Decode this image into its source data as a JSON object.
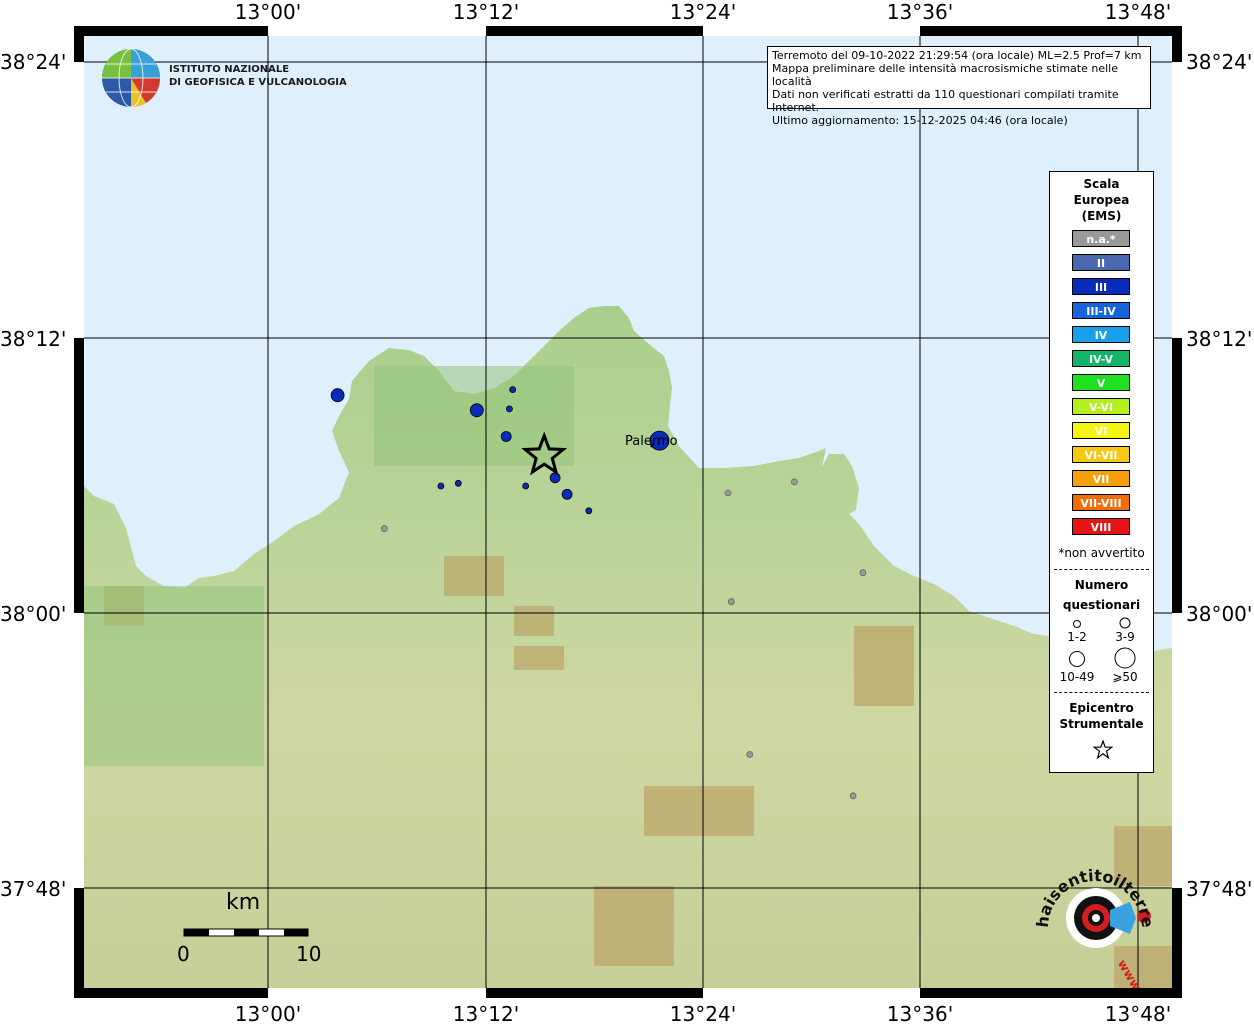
{
  "axes": {
    "lon_labels": [
      "13°00'",
      "13°12'",
      "13°24'",
      "13°36'",
      "13°48'"
    ],
    "lat_labels": [
      "38°24'",
      "38°12'",
      "38°00'",
      "37°48'"
    ]
  },
  "institute": {
    "name_line1": "ISTITUTO NAZIONALE",
    "name_line2": "DI GEOFISICA E VULCANOLOGIA"
  },
  "info_box": {
    "line1": "Terremoto del 09-10-2022 21:29:54 (ora locale) ML=2.5 Prof=7 km",
    "line2": "Mappa preliminare delle intensità macrosismiche stimate nelle località",
    "line3": "Dati non verificati estratti da 110 questionari compilati tramite Internet.",
    "line4": "Ultimo aggiornamento: 15-12-2025 04:46 (ora locale)"
  },
  "legend": {
    "title_line1": "Scala",
    "title_line2": "Europea",
    "title_line3": "(EMS)",
    "scale": [
      {
        "label": "n.a.*",
        "color": "#999999"
      },
      {
        "label": "II",
        "color": "#4a67b0"
      },
      {
        "label": "III",
        "color": "#0a2cba"
      },
      {
        "label": "III-IV",
        "color": "#1565d8"
      },
      {
        "label": "IV",
        "color": "#1aa0e8"
      },
      {
        "label": "IV-V",
        "color": "#14b46a"
      },
      {
        "label": "V",
        "color": "#1ee01e"
      },
      {
        "label": "V-VI",
        "color": "#b4f01e"
      },
      {
        "label": "VI",
        "color": "#f5f514"
      },
      {
        "label": "VI-VII",
        "color": "#f5c814"
      },
      {
        "label": "VII",
        "color": "#f5a00a"
      },
      {
        "label": "VII-VIII",
        "color": "#f06e0a"
      },
      {
        "label": "VIII",
        "color": "#e61414"
      }
    ],
    "not_felt_note": "*non avvertito",
    "count_title_line1": "Numero",
    "count_title_line2": "questionari",
    "count_labels": [
      "1-2",
      "3-9",
      "10-49",
      "⩾50"
    ],
    "epicenter_line1": "Epicentro",
    "epicenter_line2": "Strumentale"
  },
  "city": {
    "name": "Palermo"
  },
  "scale_bar": {
    "unit": "km",
    "start": "0",
    "end": "10"
  },
  "site_logo": {
    "text": "haisentitoilterremoto.it",
    "sub": "www."
  },
  "observations": [
    {
      "lon": 13.064,
      "lat": 38.158,
      "intensity": "III",
      "count": "10-49"
    },
    {
      "lon": 13.192,
      "lat": 38.147,
      "intensity": "III",
      "count": "10-49"
    },
    {
      "lon": 13.219,
      "lat": 38.128,
      "intensity": "III",
      "count": "3-9"
    },
    {
      "lon": 13.225,
      "lat": 38.162,
      "intensity": "III",
      "count": "1-2"
    },
    {
      "lon": 13.222,
      "lat": 38.148,
      "intensity": "III",
      "count": "1-2"
    },
    {
      "lon": 13.36,
      "lat": 38.125,
      "intensity": "III",
      "count": ">=50"
    },
    {
      "lon": 13.264,
      "lat": 38.098,
      "intensity": "III",
      "count": "3-9"
    },
    {
      "lon": 13.237,
      "lat": 38.092,
      "intensity": "III",
      "count": "1-2"
    },
    {
      "lon": 13.275,
      "lat": 38.086,
      "intensity": "III",
      "count": "3-9"
    },
    {
      "lon": 13.159,
      "lat": 38.092,
      "intensity": "III",
      "count": "1-2"
    },
    {
      "lon": 13.175,
      "lat": 38.094,
      "intensity": "III",
      "count": "1-2"
    },
    {
      "lon": 13.295,
      "lat": 38.074,
      "intensity": "III",
      "count": "1-2"
    },
    {
      "lon": 13.107,
      "lat": 38.061,
      "intensity": "n.a.",
      "count": "1-2"
    },
    {
      "lon": 13.423,
      "lat": 38.087,
      "intensity": "n.a.",
      "count": "1-2"
    },
    {
      "lon": 13.484,
      "lat": 38.095,
      "intensity": "n.a.",
      "count": "1-2"
    },
    {
      "lon": 13.547,
      "lat": 38.029,
      "intensity": "n.a.",
      "count": "1-2"
    },
    {
      "lon": 13.426,
      "lat": 38.008,
      "intensity": "n.a.",
      "count": "1-2"
    },
    {
      "lon": 13.443,
      "lat": 37.897,
      "intensity": "n.a.",
      "count": "1-2"
    },
    {
      "lon": 13.538,
      "lat": 37.867,
      "intensity": "n.a.",
      "count": "1-2"
    }
  ],
  "epicenter": {
    "lon": 13.254,
    "lat": 38.114
  }
}
